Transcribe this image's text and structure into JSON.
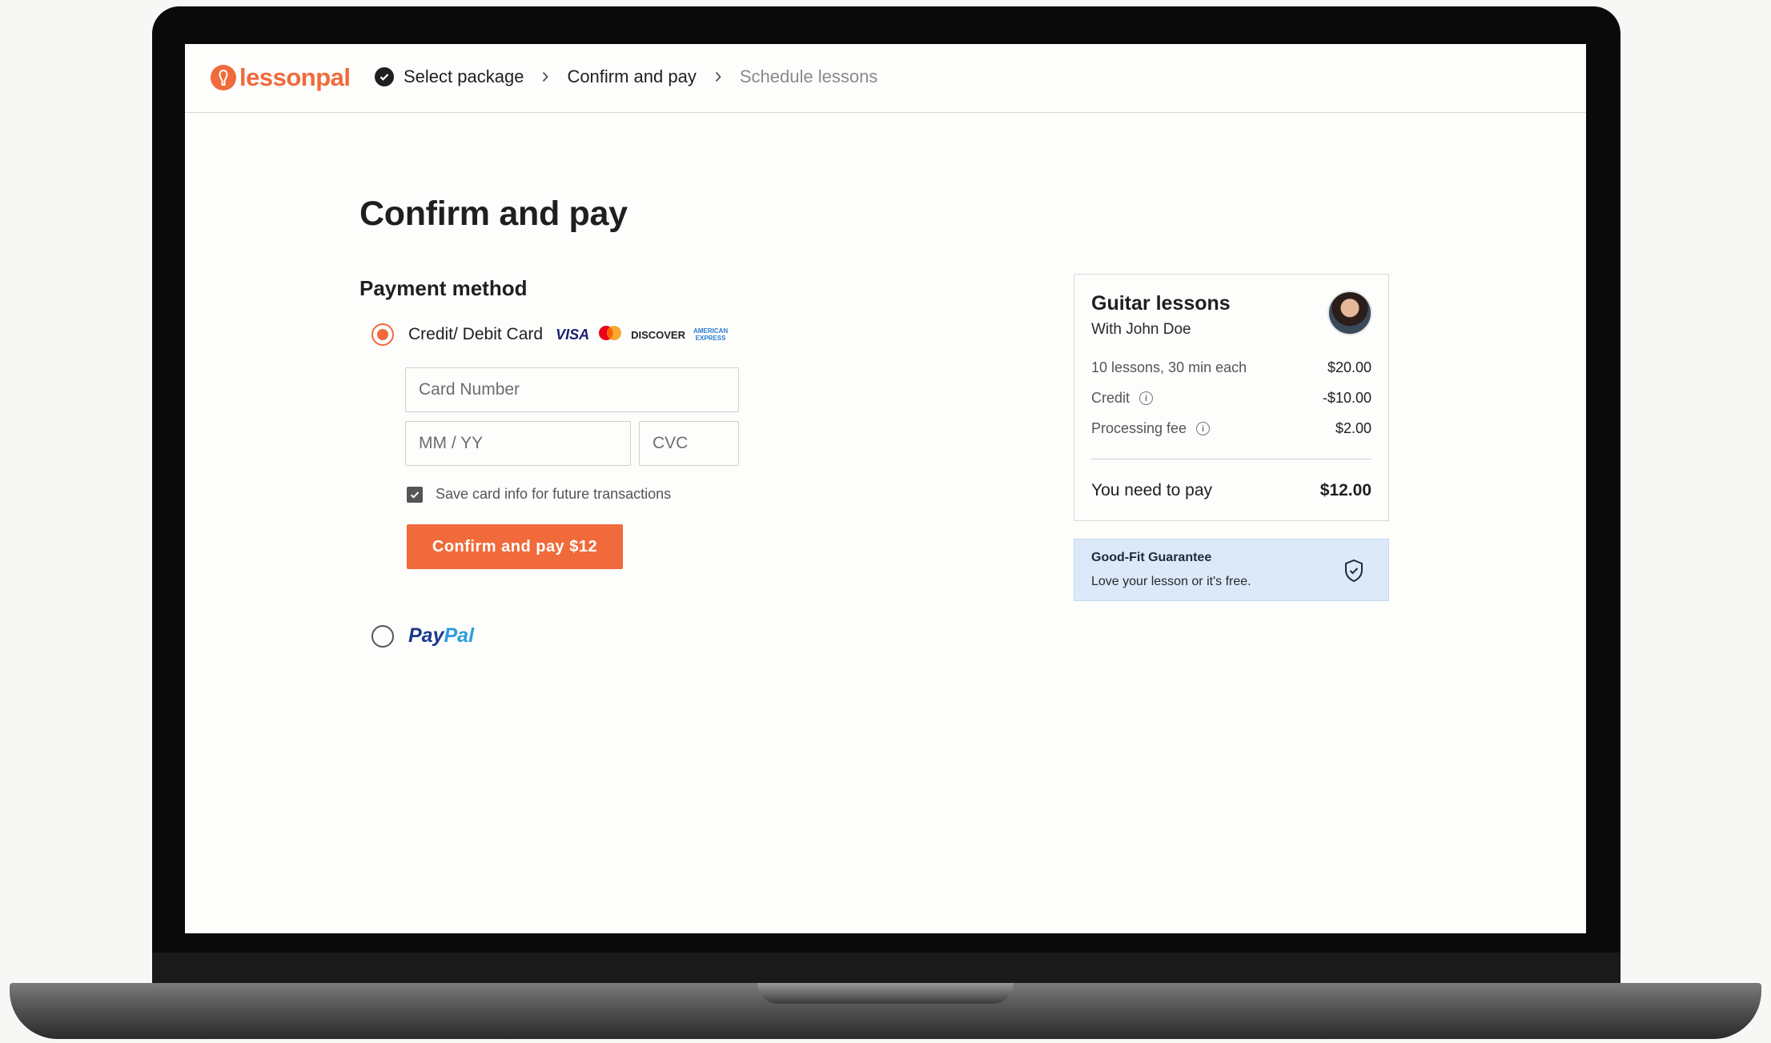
{
  "brand": {
    "logo_text": "lessonpal",
    "accent": "#f06a3b"
  },
  "steps": [
    {
      "label": "Select package",
      "state": "done"
    },
    {
      "label": "Confirm and pay",
      "state": "current"
    },
    {
      "label": "Schedule lessons",
      "state": "upcoming"
    }
  ],
  "page": {
    "title": "Confirm and pay"
  },
  "payment": {
    "section_title": "Payment method",
    "card_option_label": "Credit/ Debit Card",
    "card_selected": true,
    "brands": {
      "visa": "VISA",
      "discover": "DISCOVER",
      "amex_line1": "AMERICAN",
      "amex_line2": "EXPRESS"
    },
    "card_number_placeholder": "Card Number",
    "expiry_placeholder": "MM / YY",
    "cvc_placeholder": "CVC",
    "save_card_label": "Save card info for future transactions",
    "save_card_checked": true,
    "pay_button_label": "Confirm and pay $12",
    "paypal_part1": "Pay",
    "paypal_part2": "Pal",
    "paypal_selected": false
  },
  "summary": {
    "title": "Guitar lessons",
    "subtitle": "With John Doe",
    "rows": [
      {
        "label": "10 lessons, 30 min each",
        "amount": "$20.00"
      },
      {
        "label": "Credit",
        "amount": "-$10.00"
      },
      {
        "label": "Processing fee",
        "amount": "$2.00"
      }
    ],
    "total_label": "You need to pay",
    "total_amount": "$12.00"
  },
  "guarantee": {
    "title": "Good-Fit Guarantee",
    "subtitle": "Love your lesson or it's free."
  }
}
